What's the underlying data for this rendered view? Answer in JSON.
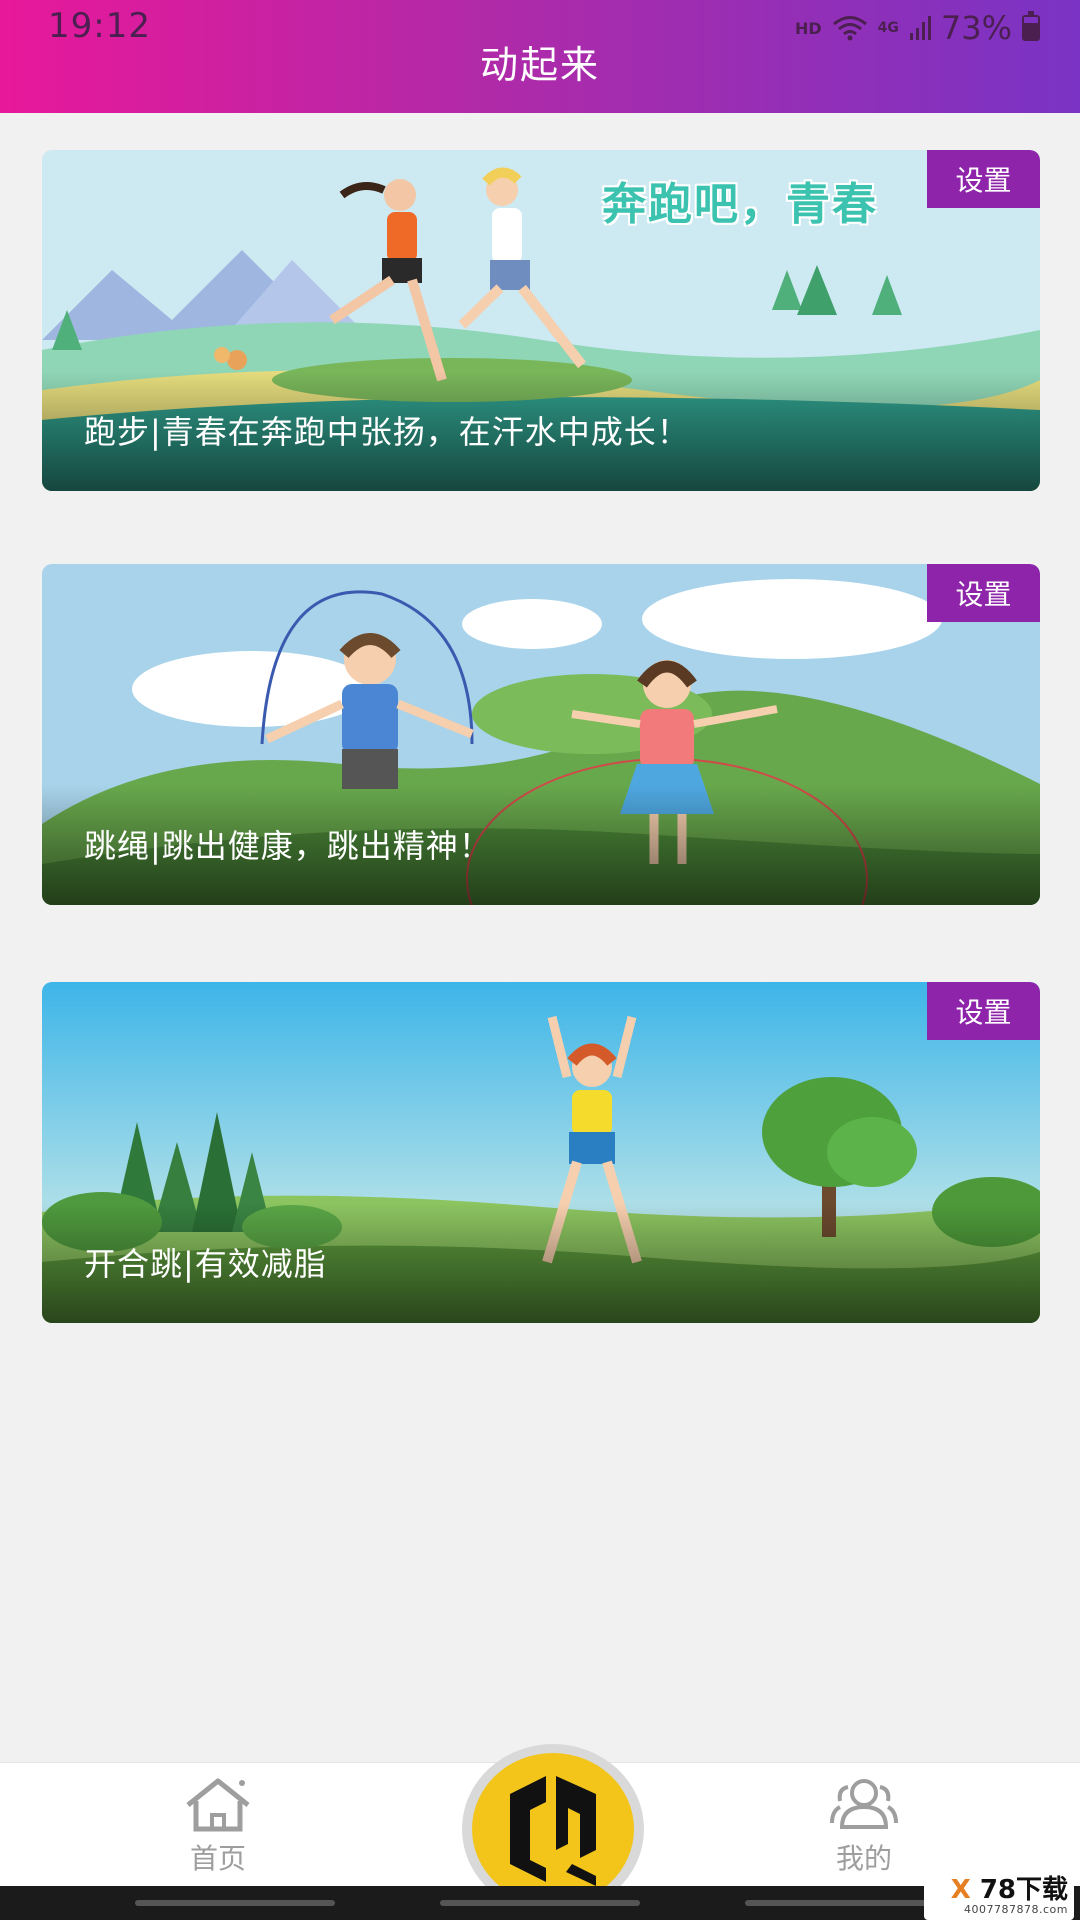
{
  "status_bar": {
    "time": "19:12",
    "hd": "HD",
    "network": "4G",
    "battery": "73%"
  },
  "header": {
    "title": "动起来"
  },
  "cards": [
    {
      "banner_text": "奔跑吧，青春",
      "caption": "跑步|青春在奔跑中张扬，在汗水中成长！",
      "badge": "设置"
    },
    {
      "caption": "跳绳|跳出健康，跳出精神！",
      "badge": "设置"
    },
    {
      "caption": "开合跳|有效减脂",
      "badge": "设置"
    }
  ],
  "tabbar": {
    "home_label": "首页",
    "mine_label": "我的",
    "home_icon": "home-icon",
    "mine_icon": "users-icon"
  },
  "watermark": {
    "main_x": "X",
    "main": "78下载",
    "sub": "4007787878.com"
  },
  "colors": {
    "accent": "#8e24aa",
    "header_start": "#e8189a",
    "header_end": "#7a33c4",
    "center_button": "#f3c51a"
  }
}
